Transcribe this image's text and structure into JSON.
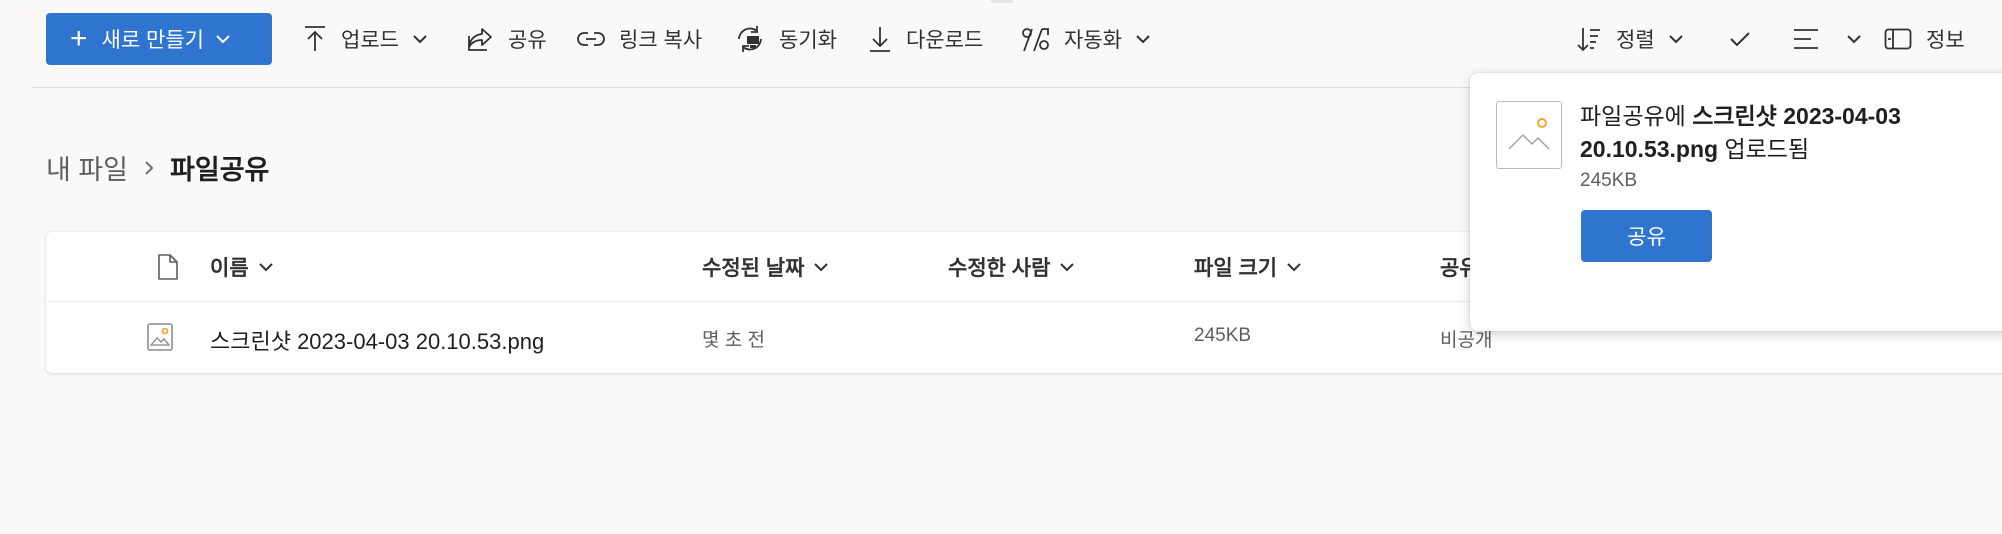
{
  "toolbar": {
    "new_label": "새로 만들기",
    "upload_label": "업로드",
    "share_label": "공유",
    "copy_link_label": "링크 복사",
    "sync_label": "동기화",
    "download_label": "다운로드",
    "automate_label": "자동화",
    "sort_label": "정렬",
    "info_label": "정보"
  },
  "breadcrumb": {
    "root": "내 파일",
    "current": "파일공유"
  },
  "table": {
    "columns": {
      "name": "이름",
      "modified": "수정된 날짜",
      "modified_by": "수정한 사람",
      "size": "파일 크기",
      "sharing": "공유"
    },
    "rows": [
      {
        "name": "스크린샷 2023-04-03 20.10.53.png",
        "modified": "몇 초 전",
        "modified_by": "",
        "size": "245KB",
        "sharing": "비공개"
      }
    ]
  },
  "notification": {
    "folder": "파일공유에",
    "filename": "스크린샷 2023-04-03 20.10.53.png",
    "suffix": "업로드됨",
    "size": "245KB",
    "button_label": "공유"
  },
  "colors": {
    "accent": "#2f74cf",
    "background": "#faf9f8",
    "image_icon_accent": "#f7a21b"
  },
  "icons": {
    "upload": "arrow-up-icon",
    "share": "share-icon",
    "copy_link": "link-icon",
    "sync": "sync-icon",
    "download": "arrow-down-icon",
    "automate": "flow-icon",
    "sort": "sort-icon",
    "view": "list-view-icon",
    "info": "info-pane-icon",
    "file_type": "document-icon",
    "image_file": "image-file-icon"
  }
}
